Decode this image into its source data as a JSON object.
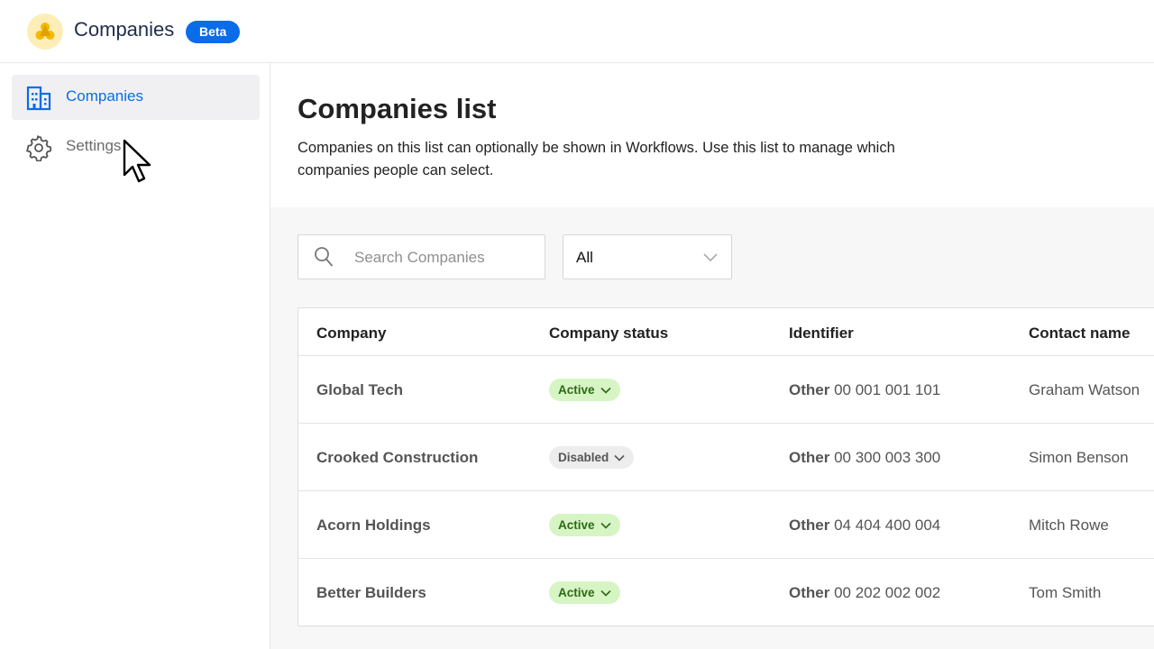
{
  "app": {
    "title": "Companies",
    "badge": "Beta"
  },
  "sidebar": {
    "items": [
      {
        "label": "Companies",
        "icon": "building-icon",
        "active": true
      },
      {
        "label": "Settings",
        "icon": "gear-icon",
        "active": false
      }
    ]
  },
  "main": {
    "title": "Companies list",
    "description": "Companies on this list can optionally be shown in Workflows. Use this list to manage which companies people can select."
  },
  "filters": {
    "search_placeholder": "Search Companies",
    "search_value": "",
    "status_selected": "All"
  },
  "table": {
    "columns": [
      "Company",
      "Company status",
      "Identifier",
      "Contact name"
    ],
    "rows": [
      {
        "company": "Global Tech",
        "status": "Active",
        "id_type": "Other",
        "id_value": "00 001 001 101",
        "contact": "Graham Watson"
      },
      {
        "company": "Crooked Construction",
        "status": "Disabled",
        "id_type": "Other",
        "id_value": "00 300 003 300",
        "contact": "Simon Benson"
      },
      {
        "company": "Acorn Holdings",
        "status": "Active",
        "id_type": "Other",
        "id_value": "04 404 400 004",
        "contact": "Mitch Rowe"
      },
      {
        "company": "Better Builders",
        "status": "Active",
        "id_type": "Other",
        "id_value": "00 202 002 002",
        "contact": "Tom Smith"
      }
    ]
  },
  "colors": {
    "accent": "#0a6ce8",
    "active_pill_bg": "#d7f5c4",
    "active_pill_text": "#2c6a16",
    "disabled_pill_bg": "#ededed",
    "logo_bg": "#fdeeb8"
  }
}
